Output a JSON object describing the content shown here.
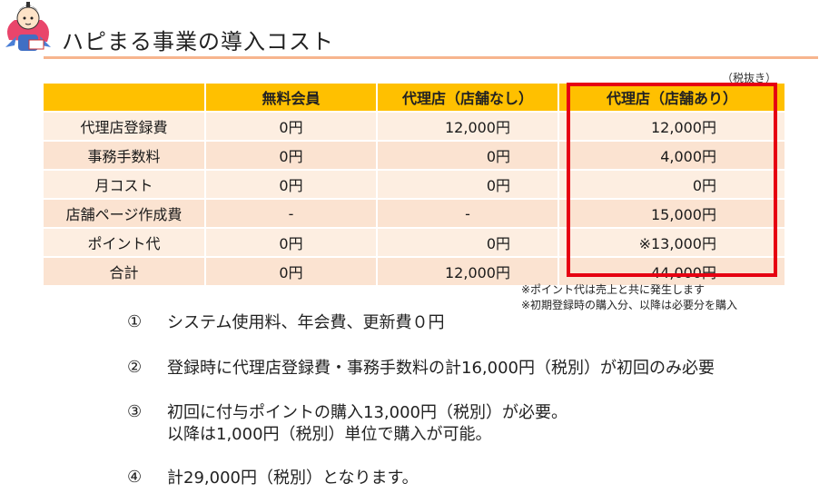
{
  "title": "ハピまる事業の導入コスト",
  "tax_note": "（税抜き）",
  "table": {
    "headers": [
      "",
      "無料会員",
      "代理店（店舗なし）",
      "代理店（店舗あり）"
    ],
    "rows": [
      [
        "代理店登録費",
        "0円",
        "12,000円",
        "12,000円"
      ],
      [
        "事務手数料",
        "0円",
        "0円",
        "4,000円"
      ],
      [
        "月コスト",
        "0円",
        "0円",
        "0円"
      ],
      [
        "店舗ページ作成費",
        "-",
        "-",
        "15,000円"
      ],
      [
        "ポイント代",
        "0円",
        "0円",
        "※13,000円"
      ],
      [
        "合計",
        "0円",
        "12,000円",
        "44,000円"
      ]
    ]
  },
  "footnotes": [
    "※ポイント代は売上と共に発生します",
    "※初期登録時の購入分、以降は必要分を購入"
  ],
  "points": [
    {
      "num": "①",
      "lines": [
        "システム使用料、年会費、更新費０円"
      ]
    },
    {
      "num": "②",
      "lines": [
        "登録時に代理店登録費・事務手数料の計16,000円（税別）が初回のみ必要"
      ]
    },
    {
      "num": "③",
      "lines": [
        "初回に付与ポイントの購入13,000円（税別）が必要。",
        "以降は1,000円（税別）単位で購入が可能。"
      ]
    },
    {
      "num": "④",
      "lines": [
        "計29,000円（税別）となります。"
      ]
    }
  ],
  "accent_colors": {
    "header": "#ffc000",
    "highlight_border": "#e60012",
    "rule": "#f7b58e"
  }
}
